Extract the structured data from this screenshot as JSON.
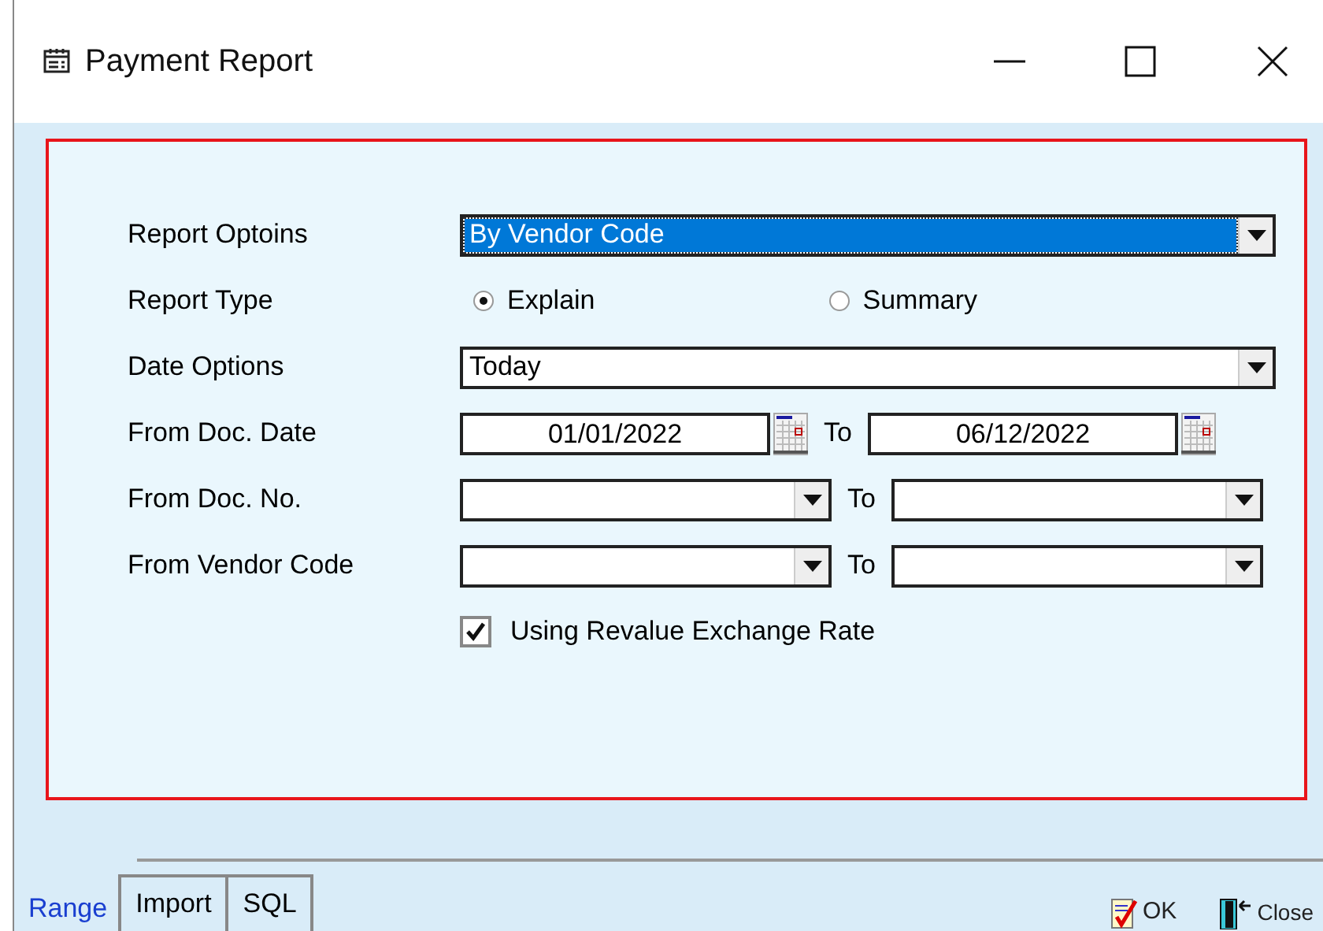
{
  "window": {
    "title": "Payment Report"
  },
  "fields": [
    {
      "kind": "dropdown",
      "label": "Report Optoins",
      "value": "By Vendor Code",
      "selected": true
    },
    {
      "kind": "radio",
      "label": "Report Type",
      "options": [
        {
          "label": "Explain",
          "selected": true
        },
        {
          "label": "Summary",
          "selected": false
        }
      ]
    },
    {
      "kind": "dropdown",
      "label": "Date Options",
      "value": "Today",
      "selected": false
    },
    {
      "kind": "date_range",
      "label": "From Doc. Date",
      "from": "01/01/2022",
      "to_label": "To",
      "to": "06/12/2022"
    },
    {
      "kind": "combo_range",
      "label": "From Doc. No.",
      "to_label": "To"
    },
    {
      "kind": "combo_range",
      "label": "From Vendor Code",
      "to_label": "To"
    },
    {
      "kind": "checkbox",
      "label": "Using Revalue Exchange Rate",
      "checked": true
    }
  ],
  "tabs": [
    {
      "label": "Range",
      "selected": true
    },
    {
      "label": "Import",
      "selected": false
    },
    {
      "label": "SQL",
      "selected": false
    }
  ],
  "buttons": [
    {
      "kind": "ok",
      "label": "OK"
    },
    {
      "kind": "close",
      "label": "Close"
    }
  ]
}
